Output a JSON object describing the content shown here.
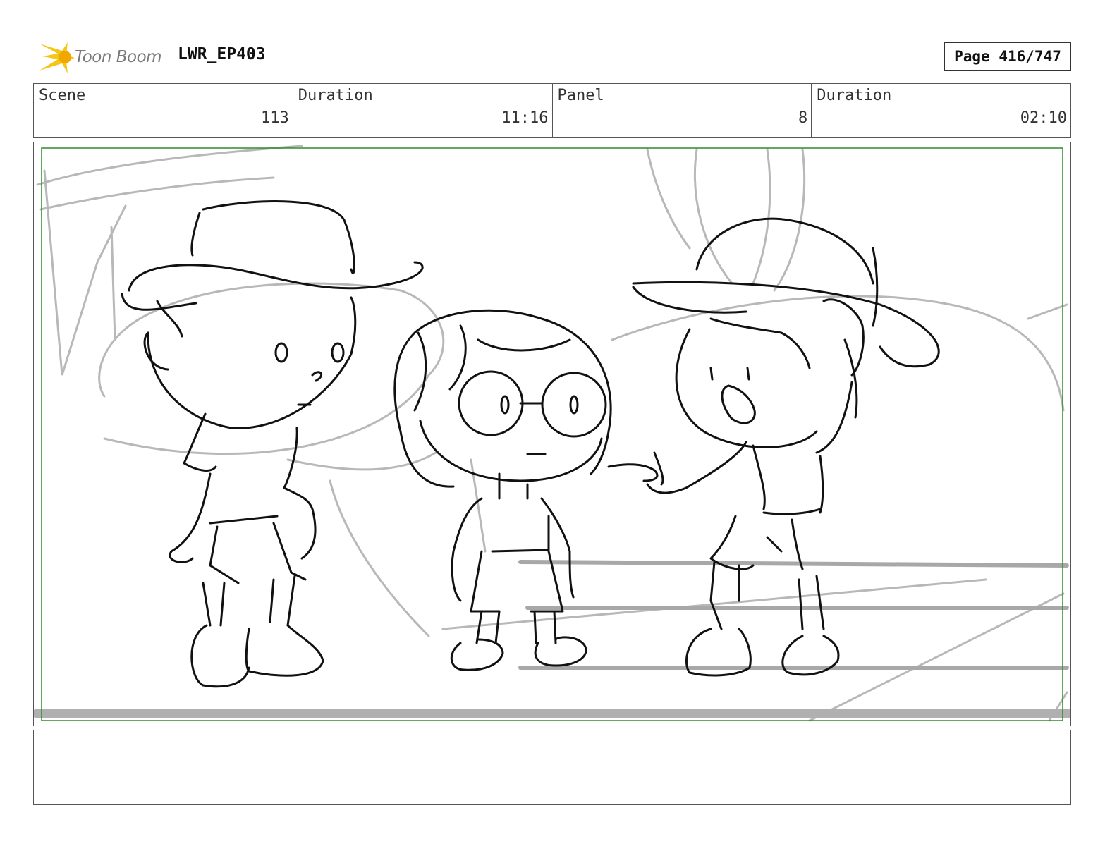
{
  "header": {
    "logo_text": "Toon Boom",
    "project_title": "LWR_EP403",
    "page_label": "Page 416/747"
  },
  "info_bar": {
    "scene_label": "Scene",
    "scene_value": "113",
    "scene_duration_label": "Duration",
    "scene_duration_value": "11:16",
    "panel_label": "Panel",
    "panel_value": "8",
    "panel_duration_label": "Duration",
    "panel_duration_value": "02:10"
  },
  "notes": {
    "text": ""
  },
  "colors": {
    "logo_yellow": "#f5c518",
    "safe_frame_green": "#2e8b2e",
    "rough_gray": "#b8b8b8",
    "ink": "#111111"
  }
}
